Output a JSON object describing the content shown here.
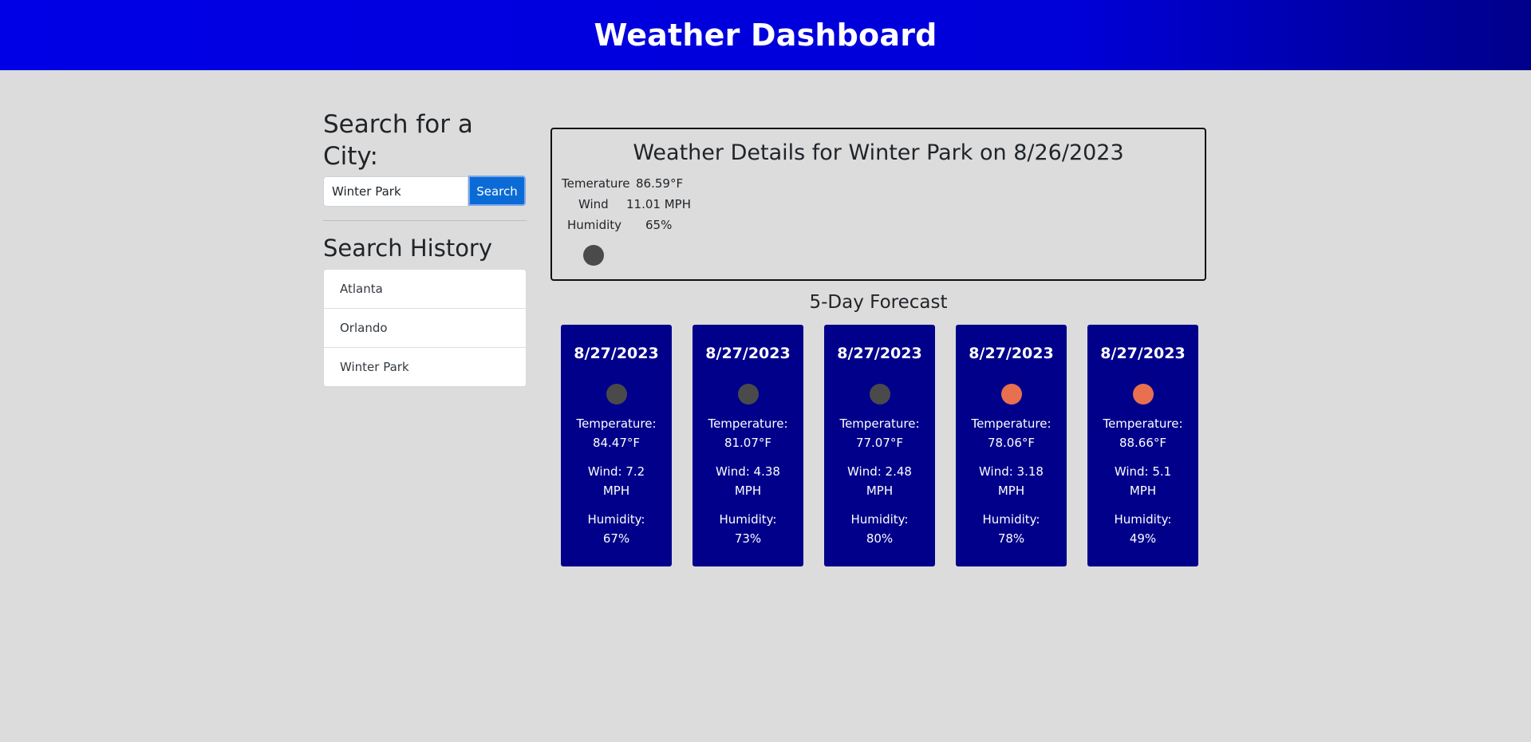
{
  "header": {
    "title": "Weather Dashboard"
  },
  "sidebar": {
    "search_heading": "Search for a City:",
    "search_value": "Winter Park",
    "search_button": "Search",
    "history_heading": "Search History",
    "history": [
      {
        "label": "Atlanta"
      },
      {
        "label": "Orlando"
      },
      {
        "label": "Winter Park"
      }
    ]
  },
  "current": {
    "title": "Weather Details for Winter Park on 8/26/2023",
    "temperature_label": "Temerature",
    "temperature_value": "86.59°F",
    "wind_label": "Wind",
    "wind_value": "11.01 MPH",
    "humidity_label": "Humidity",
    "humidity_value": "65%",
    "icon": "clouds-icon",
    "icon_color": "#4a4a4a"
  },
  "forecast": {
    "title": "5-Day Forecast",
    "cards": [
      {
        "date": "8/27/2023",
        "icon": "clouds-icon",
        "icon_color": "#4a4a4a",
        "temp_label": "Temperature:",
        "temp_value": "84.47°F",
        "wind_label": "Wind: 7.2",
        "wind_unit": "MPH",
        "humidity_label": "Humidity:",
        "humidity_value": "67%"
      },
      {
        "date": "8/27/2023",
        "icon": "clouds-icon",
        "icon_color": "#4a4a4a",
        "temp_label": "Temperature:",
        "temp_value": "81.07°F",
        "wind_label": "Wind: 4.38",
        "wind_unit": "MPH",
        "humidity_label": "Humidity:",
        "humidity_value": "73%"
      },
      {
        "date": "8/27/2023",
        "icon": "clouds-icon",
        "icon_color": "#4a4a4a",
        "temp_label": "Temperature:",
        "temp_value": "77.07°F",
        "wind_label": "Wind: 2.48",
        "wind_unit": "MPH",
        "humidity_label": "Humidity:",
        "humidity_value": "80%"
      },
      {
        "date": "8/27/2023",
        "icon": "sun-icon",
        "icon_color": "#e8704f",
        "temp_label": "Temperature:",
        "temp_value": "78.06°F",
        "wind_label": "Wind: 3.18",
        "wind_unit": "MPH",
        "humidity_label": "Humidity:",
        "humidity_value": "78%"
      },
      {
        "date": "8/27/2023",
        "icon": "sun-icon",
        "icon_color": "#e8704f",
        "temp_label": "Temperature:",
        "temp_value": "88.66°F",
        "wind_label": "Wind: 5.1",
        "wind_unit": "MPH",
        "humidity_label": "Humidity:",
        "humidity_value": "49%"
      }
    ]
  }
}
